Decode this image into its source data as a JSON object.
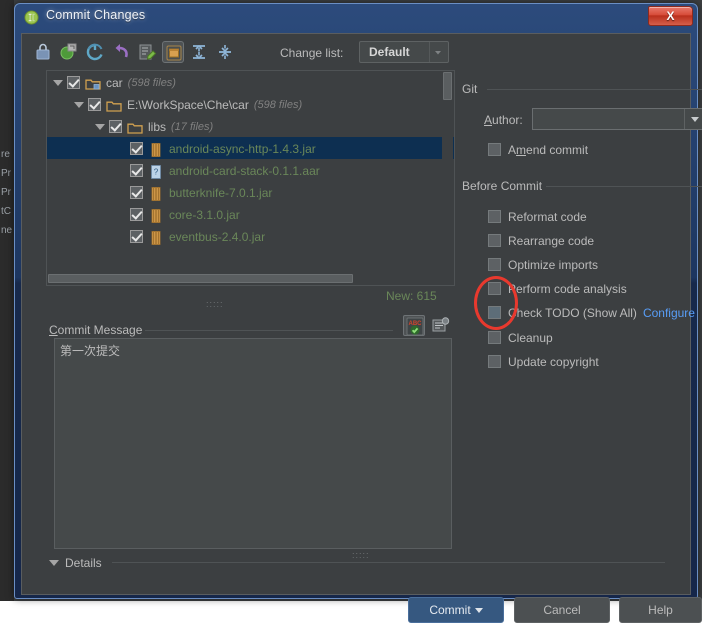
{
  "window": {
    "title": "Commit Changes",
    "app_icon": "intellij-idea-icon",
    "close_label": "X"
  },
  "background": {
    "editor_fragments": [
      "re",
      "Pr",
      "Pr",
      "tC",
      "ne"
    ]
  },
  "toolbar": {
    "icons": [
      {
        "name": "show-diff-icon",
        "glyph": "◧",
        "selected": false
      },
      {
        "name": "revert-to-icon",
        "glyph": "◑",
        "selected": false
      },
      {
        "name": "refresh-icon",
        "glyph": "↻",
        "selected": false
      },
      {
        "name": "rollback-icon",
        "glyph": "↩",
        "selected": false
      },
      {
        "name": "edit-source-icon",
        "glyph": "✎",
        "selected": false
      },
      {
        "name": "group-by-module-icon",
        "glyph": "▣",
        "selected": true
      },
      {
        "name": "expand-all-icon",
        "glyph": "↕",
        "selected": false
      },
      {
        "name": "collapse-all-icon",
        "glyph": "↔",
        "selected": false
      }
    ],
    "changelist_label": "Change list:",
    "changelist_value": "Default"
  },
  "tree": {
    "rows": [
      {
        "indent": 0,
        "twisty": true,
        "checked": true,
        "icon": "module-folder-icon",
        "name": "car",
        "name_color": "white",
        "count": "(598 files)",
        "selected": false
      },
      {
        "indent": 1,
        "twisty": true,
        "checked": true,
        "icon": "folder-icon",
        "name": "E:\\WorkSpace\\Che\\car",
        "name_color": "white",
        "count": "(598 files)",
        "selected": false
      },
      {
        "indent": 2,
        "twisty": true,
        "checked": true,
        "icon": "folder-icon",
        "name": "libs",
        "name_color": "white",
        "count": "(17 files)",
        "selected": false
      },
      {
        "indent": 3,
        "twisty": false,
        "checked": true,
        "icon": "jar-file-icon",
        "name": "android-async-http-1.4.3.jar",
        "name_color": "green",
        "count": "",
        "selected": true
      },
      {
        "indent": 3,
        "twisty": false,
        "checked": true,
        "icon": "aar-file-icon",
        "name": "android-card-stack-0.1.1.aar",
        "name_color": "green",
        "count": "",
        "selected": false
      },
      {
        "indent": 3,
        "twisty": false,
        "checked": true,
        "icon": "jar-file-icon",
        "name": "butterknife-7.0.1.jar",
        "name_color": "green",
        "count": "",
        "selected": false
      },
      {
        "indent": 3,
        "twisty": false,
        "checked": true,
        "icon": "jar-file-icon",
        "name": "core-3.1.0.jar",
        "name_color": "green",
        "count": "",
        "selected": false
      },
      {
        "indent": 3,
        "twisty": false,
        "checked": true,
        "icon": "jar-file-icon",
        "name": "eventbus-2.4.0.jar",
        "name_color": "green",
        "count": "",
        "selected": false
      }
    ],
    "new_count": "New: 615"
  },
  "commit_message": {
    "label": "Commit Message",
    "label_mnemonic": "C",
    "value": "第一次提交",
    "spellcheck_icon": "spellcheck-abc-icon",
    "history_icon": "message-history-icon"
  },
  "git_group": {
    "title": "Git",
    "author_label": "Author:",
    "author_mnemonic": "A",
    "author_value": "",
    "amend_label": "Amend commit",
    "amend_mnemonic": "m",
    "amend_checked": false
  },
  "before_commit_group": {
    "title": "Before Commit",
    "options": [
      {
        "label": "Reformat code",
        "mnemonic": "R",
        "checked": false,
        "highlight": false
      },
      {
        "label": "Rearrange code",
        "mnemonic": "n",
        "checked": false,
        "highlight": false
      },
      {
        "label": "Optimize imports",
        "mnemonic": "O",
        "checked": false,
        "highlight": false
      },
      {
        "label": "Perform code analysis",
        "mnemonic": "s",
        "checked": false,
        "highlight": false
      },
      {
        "label": "Check TODO (Show All)",
        "mnemonic": "k",
        "checked": false,
        "highlight": true,
        "link": "Configure"
      },
      {
        "label": "Cleanup",
        "mnemonic": "l",
        "checked": false,
        "highlight": false
      },
      {
        "label": "Update copyright",
        "mnemonic": "U",
        "checked": false,
        "highlight": false
      }
    ]
  },
  "annotation": {
    "shape": "red-ellipse",
    "color": "#e8392e"
  },
  "footer": {
    "details_label": "Details",
    "commit_label": "Commit",
    "cancel_label": "Cancel",
    "help_label": "Help"
  }
}
